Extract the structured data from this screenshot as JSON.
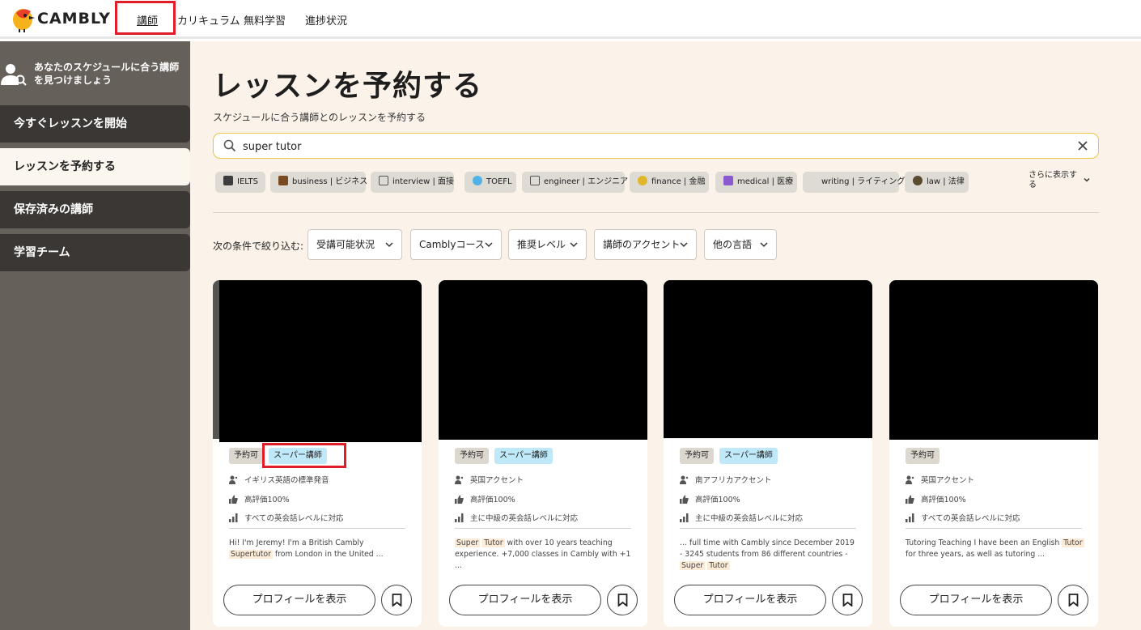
{
  "brand": {
    "name": "CAMBLY"
  },
  "nav": {
    "items": [
      "講師",
      "カリキュラム",
      "無料学習",
      "進捗状況"
    ],
    "active": "講師"
  },
  "sidebar": {
    "header": "あなたのスケジュールに合う講師を見つけましょう",
    "items": [
      {
        "label": "今すぐレッスンを開始",
        "active": false
      },
      {
        "label": "レッスンを予約する",
        "active": true
      },
      {
        "label": "保存済みの講師",
        "active": false
      },
      {
        "label": "学習チーム",
        "active": false
      }
    ]
  },
  "main": {
    "title": "レッスンを予約する",
    "subtitle": "スケジュールに合う講師とのレッスンを予約する",
    "search": {
      "value": "super tutor"
    },
    "chips": [
      {
        "label": "IELTS",
        "icon": "graduation-cap-icon"
      },
      {
        "label": "business | ビジネス",
        "icon": "briefcase-icon"
      },
      {
        "label": "interview | 面接",
        "icon": "pen-icon"
      },
      {
        "label": "TOEFL",
        "icon": "globe-icon"
      },
      {
        "label": "engineer | エンジニア",
        "icon": "wrench-icon"
      },
      {
        "label": "finance | 金融",
        "icon": "money-bag-icon"
      },
      {
        "label": "medical | 医療",
        "icon": "medical-icon"
      },
      {
        "label": "writing | ライティング",
        "icon": "writing-icon"
      },
      {
        "label": "law | 法律",
        "icon": "scales-icon"
      }
    ],
    "more_label": "さらに表示する",
    "filter_label": "次の条件で絞り込む:",
    "filters": [
      "受講可能状況",
      "Camblyコース",
      "推奨レベル",
      "講師のアクセント",
      "他の言語"
    ]
  },
  "cards": [
    {
      "badges": [
        "予約可",
        "スーパー講師"
      ],
      "accent": "イギリス英語の標準発音",
      "rating": "高評価100%",
      "level": "すべての英会話レベルに対応",
      "bio_parts": [
        "Hi! I'm Jeremy! I'm a British Cambly ",
        "Supertutor",
        " from London in the United ..."
      ],
      "profile_label": "プロフィールを表示"
    },
    {
      "badges": [
        "予約可",
        "スーパー講師"
      ],
      "accent": "英国アクセント",
      "rating": "高評価100%",
      "level": "主に中級の英会話レベルに対応",
      "bio_parts": [
        "Super",
        " ",
        "Tutor",
        " with over 10 years teaching experience. +7,000 classes in Cambly with +1 ..."
      ],
      "profile_label": "プロフィールを表示"
    },
    {
      "badges": [
        "予約可",
        "スーパー講師"
      ],
      "accent": "南アフリカアクセント",
      "rating": "高評価100%",
      "level": "主に中級の英会話レベルに対応",
      "bio_parts": [
        "... full time with Cambly since December 2019 - 3245 students from 86 different countries - ",
        "Super",
        " ",
        "Tutor"
      ],
      "profile_label": "プロフィールを表示"
    },
    {
      "badges": [
        "予約可"
      ],
      "accent": "英国アクセント",
      "rating": "高評価100%",
      "level": "すべての英会話レベルに対応",
      "bio_parts": [
        "Tutoring Teaching I have been an English ",
        "Tutor",
        " for three years, as well as tutoring ..."
      ],
      "profile_label": "プロフィールを表示"
    }
  ],
  "colors": {
    "highlight_box": "#e11d2a",
    "sidebar_bg": "#66605a",
    "main_bg": "#fbf3e9",
    "super_badge": "#bfe8f8"
  }
}
